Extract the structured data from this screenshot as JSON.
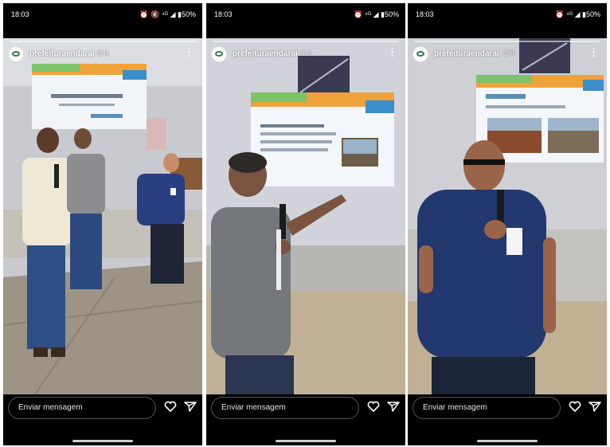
{
  "screens": [
    {
      "status_time": "18:03",
      "status_icons": "⏰ 🔇 ⁴ᴳ ◢ ▮50%",
      "account_name": "prefeituraendarai",
      "post_time": "3 h",
      "message_placeholder": "Enviar mensagem",
      "more_icon": "⋮"
    },
    {
      "status_time": "18:03",
      "status_icons": "⏰ ⁴ᴳ ◢ ▮50%",
      "account_name": "prefeituraendarai",
      "post_time": "3 h",
      "message_placeholder": "Enviar mensagem",
      "more_icon": "⋮"
    },
    {
      "status_time": "18:03",
      "status_icons": "⏰ ⁴ᴳ ◢ ▮50%",
      "account_name": "prefeituraendarai",
      "post_time": "3 h",
      "message_placeholder": "Enviar mensagem",
      "more_icon": "⋮"
    }
  ],
  "icons": [
    "profile-avatar-icon",
    "more-options-icon",
    "heart-icon",
    "send-icon"
  ],
  "colors": {
    "background": "#ffffff",
    "phone": "#000000",
    "wall": "#cfcfd4",
    "floor": "#b7a78e",
    "slide_green": "#7cc36a",
    "slide_orange": "#f0a23a",
    "slide_blue": "#3a8ec9",
    "shirt_navy": "#22386e",
    "shirt_grey": "#6f757b"
  }
}
